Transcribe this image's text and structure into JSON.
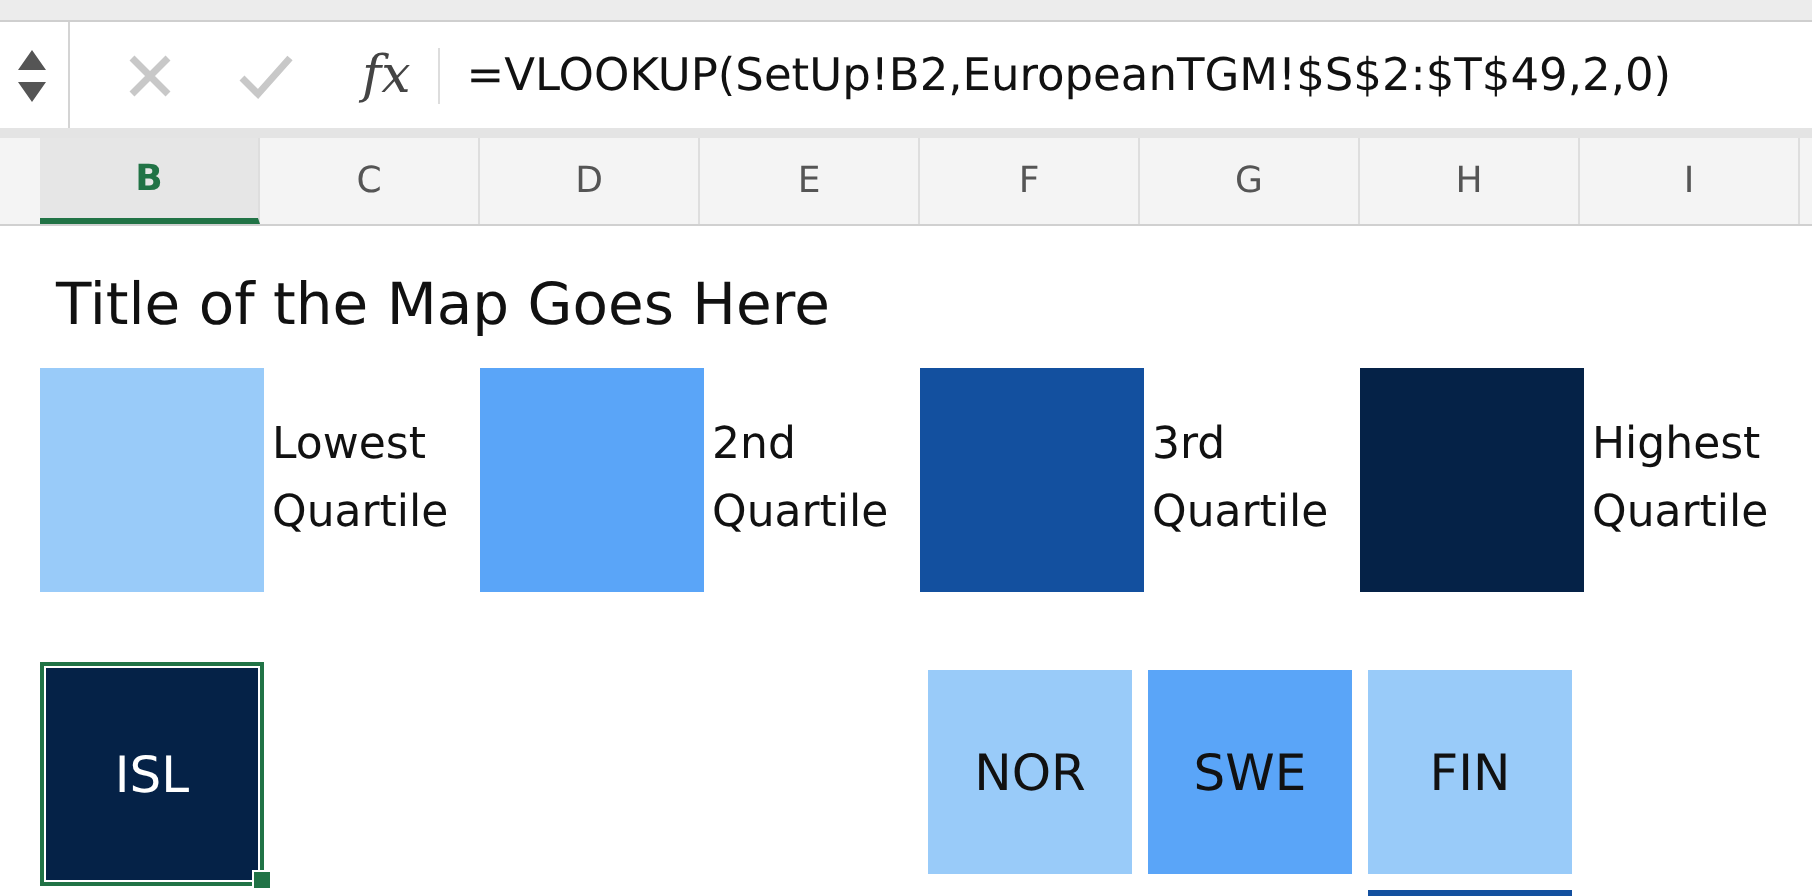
{
  "formula_bar": {
    "function_label": "fx",
    "formula": "=VLOOKUP(SetUp!B2,EuropeanTGM!$S$2:$T$49,2,0)"
  },
  "columns": [
    {
      "label": "B",
      "selected": true
    },
    {
      "label": "C",
      "selected": false
    },
    {
      "label": "D",
      "selected": false
    },
    {
      "label": "E",
      "selected": false
    },
    {
      "label": "F",
      "selected": false
    },
    {
      "label": "G",
      "selected": false
    },
    {
      "label": "H",
      "selected": false
    },
    {
      "label": "I",
      "selected": false
    }
  ],
  "title": "Title of the Map Goes Here",
  "legend": [
    {
      "label": "Lowest Quartile",
      "color": "#99cbf9"
    },
    {
      "label": "2nd Quartile",
      "color": "#5aa5f8"
    },
    {
      "label": "3rd Quartile",
      "color": "#13509f"
    },
    {
      "label": "Highest Quartile",
      "color": "#052247"
    }
  ],
  "map_rows": [
    [
      {
        "kind": "tile",
        "label": "ISL",
        "color": "#052247",
        "selected": true
      },
      {
        "kind": "empty"
      },
      {
        "kind": "empty"
      },
      {
        "kind": "empty"
      },
      {
        "kind": "tile",
        "label": "NOR",
        "color": "#99cbf9",
        "selected": false
      },
      {
        "kind": "tile",
        "label": "SWE",
        "color": "#5aa5f8",
        "selected": false
      },
      {
        "kind": "tile",
        "label": "FIN",
        "color": "#99cbf9",
        "selected": false
      }
    ],
    [
      {
        "kind": "empty"
      },
      {
        "kind": "empty"
      },
      {
        "kind": "empty"
      },
      {
        "kind": "empty"
      },
      {
        "kind": "empty"
      },
      {
        "kind": "empty"
      },
      {
        "kind": "tile",
        "color": "#13509f",
        "selected": false
      }
    ]
  ]
}
